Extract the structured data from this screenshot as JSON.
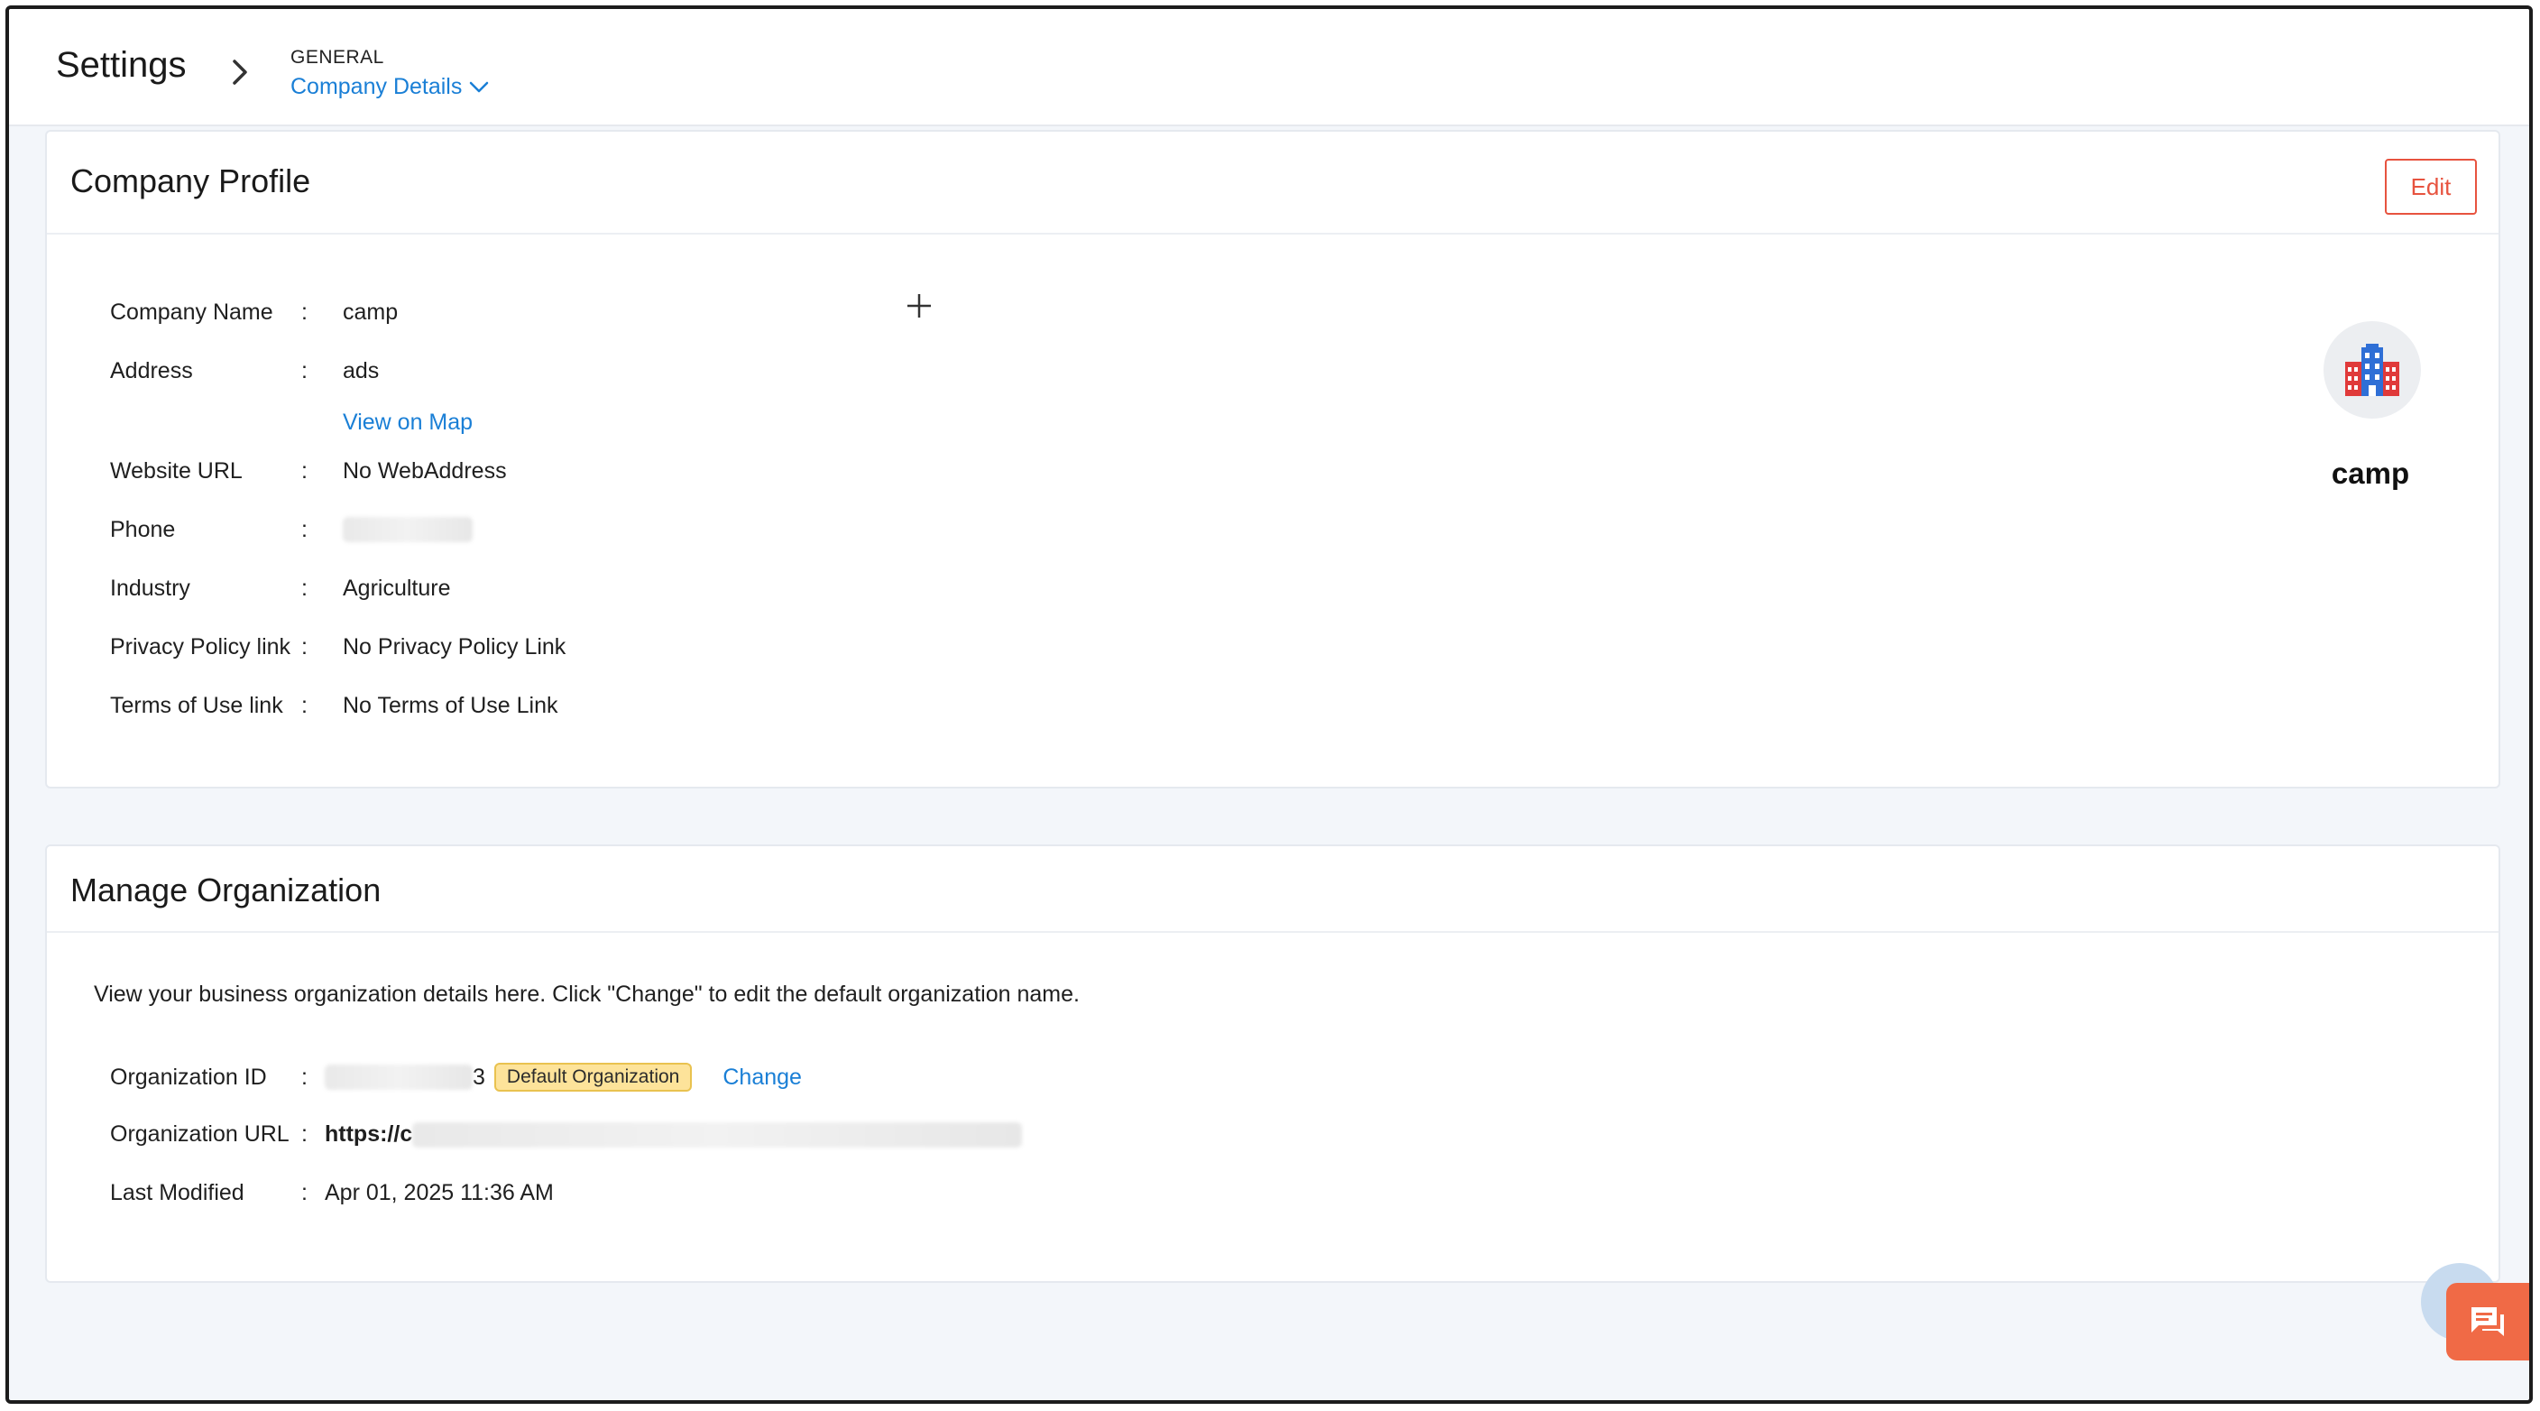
{
  "header": {
    "title": "Settings",
    "breadcrumb_group": "GENERAL",
    "breadcrumb_current": "Company Details"
  },
  "profile": {
    "title": "Company Profile",
    "edit_label": "Edit",
    "colon": ":",
    "fields": [
      {
        "label": "Company Name",
        "value": "camp"
      },
      {
        "label": "Address",
        "value": "ads"
      },
      {
        "label": "Website URL",
        "value": "No WebAddress"
      },
      {
        "label": "Phone",
        "value": ""
      },
      {
        "label": "Industry",
        "value": "Agriculture"
      },
      {
        "label": "Privacy Policy link",
        "value": "No Privacy Policy Link"
      },
      {
        "label": "Terms of Use link",
        "value": "No Terms of Use Link"
      }
    ],
    "map_link": "View on Map",
    "logo_name": "camp"
  },
  "organization": {
    "title": "Manage Organization",
    "description": "View your business organization details here. Click \"Change\" to edit the default organization name.",
    "colon": ":",
    "id_label": "Organization ID",
    "id_suffix": "3",
    "badge": "Default Organization",
    "change_label": "Change",
    "url_label": "Organization URL",
    "url_prefix": "https://c",
    "modified_label": "Last Modified",
    "modified_value": "Apr 01, 2025 11:36 AM"
  },
  "colors": {
    "accent": "#1a7fd6",
    "edit": "#e7533f",
    "badge_bg": "#fde39a",
    "chat": "#f06a46"
  }
}
